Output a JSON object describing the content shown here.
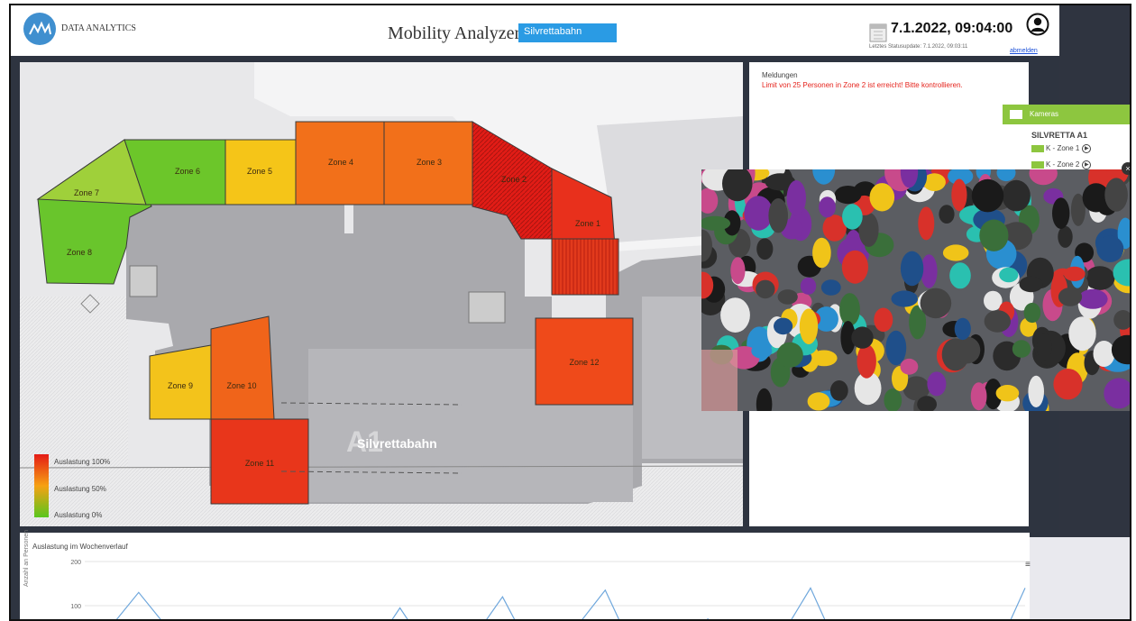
{
  "header": {
    "brand": "DATA ANALYTICS",
    "app_title": "Mobility Analyzer",
    "location_selected": "Silvrettabahn",
    "datetime": "7.1.2022, 09:04:00",
    "status_update": "Letztes Statusupdate: 7.1.2022, 09:03:11",
    "logout": "abmelden"
  },
  "map": {
    "zones": [
      {
        "label": "Zone 1",
        "color": "#e8301c"
      },
      {
        "label": "Zone 2",
        "color": "#e61c16"
      },
      {
        "label": "Zone 3",
        "color": "#f2701a"
      },
      {
        "label": "Zone 4",
        "color": "#f2701a"
      },
      {
        "label": "Zone 5",
        "color": "#f5c518"
      },
      {
        "label": "Zone 6",
        "color": "#6cc62a"
      },
      {
        "label": "Zone 7",
        "color": "#9fd03a"
      },
      {
        "label": "Zone 8",
        "color": "#69c52c"
      },
      {
        "label": "Zone 9",
        "color": "#f3c31b"
      },
      {
        "label": "Zone 10",
        "color": "#f0641a"
      },
      {
        "label": "Zone 11",
        "color": "#e8361b"
      },
      {
        "label": "Zone 12",
        "color": "#ef4a1a"
      }
    ],
    "station_code": "A1",
    "station_name": "Silvrettabahn",
    "legend": {
      "high": "Auslastung 100%",
      "mid": "Auslastung 50%",
      "low": "Auslastung 0%"
    }
  },
  "messages": {
    "title": "Meldungen",
    "alert": "Limit von 25 Personen in Zone 2 ist erreicht! Bitte kontrollieren."
  },
  "cameras": {
    "header": "Kameras",
    "section": "SILVRETTA A1",
    "items": [
      "K - Zone 1",
      "K - Zone 2"
    ]
  },
  "chart_data": {
    "type": "line",
    "title": "Auslastung im Wochenverlauf",
    "ylabel": "Anzahl an Personen",
    "yticks": [
      200,
      100
    ],
    "ylim": [
      0,
      200
    ],
    "x": [
      0,
      5,
      10,
      18,
      22,
      25,
      30,
      33,
      36,
      40,
      44,
      47,
      50,
      55,
      58,
      62,
      66,
      70,
      73,
      77,
      80,
      83,
      86,
      90,
      94,
      97,
      100
    ],
    "values": [
      0,
      130,
      0,
      20,
      25,
      0,
      0,
      95,
      0,
      0,
      120,
      0,
      0,
      135,
      0,
      0,
      70,
      0,
      0,
      140,
      0,
      0,
      60,
      0,
      12,
      0,
      140
    ]
  }
}
